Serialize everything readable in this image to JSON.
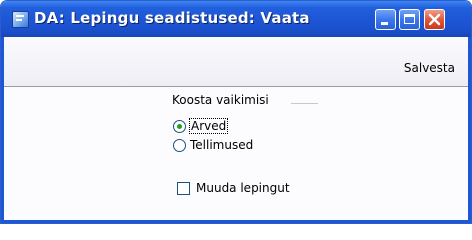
{
  "window": {
    "title": "DA: Lepingu seadistused: Vaata",
    "icon": "document-window-icon",
    "controls": [
      "minimize-icon",
      "maximize-icon",
      "close-icon"
    ]
  },
  "toolbar": {
    "save_label": "Salvesta"
  },
  "form": {
    "group_label": "Koosta vaikimisi",
    "options": [
      {
        "label": "Arved",
        "selected": true
      },
      {
        "label": "Tellimused",
        "selected": false
      }
    ],
    "checkbox": {
      "label": "Muuda lepingut",
      "checked": false
    }
  },
  "colors": {
    "titlebar": "#1d56d6",
    "close_button": "#e0573a",
    "radio_dot": "#21a121"
  }
}
